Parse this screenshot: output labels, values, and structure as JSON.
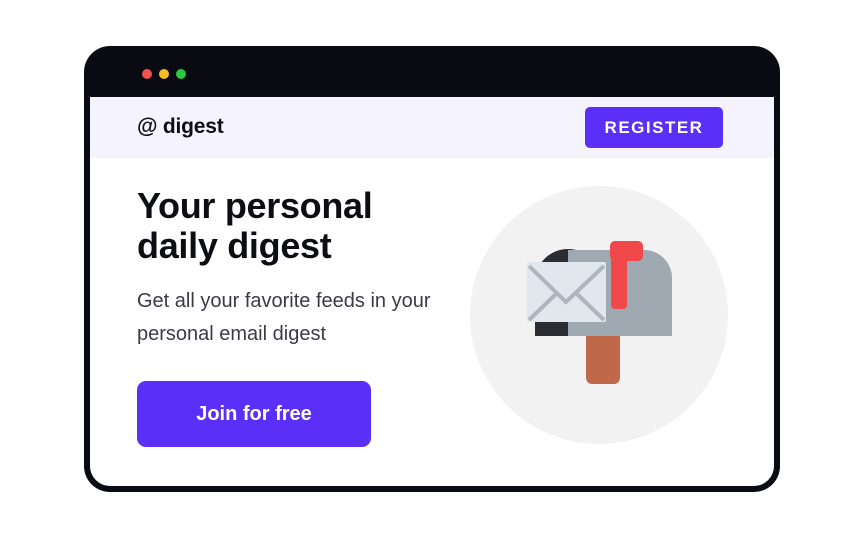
{
  "window": {
    "dots": [
      "red",
      "yellow",
      "green"
    ]
  },
  "navbar": {
    "logo_text": "@ digest",
    "register_label": "REGISTER"
  },
  "hero": {
    "title": "Your personal daily digest",
    "subtitle": "Get all your favorite feeds in your personal email digest",
    "cta_label": "Join for free"
  },
  "colors": {
    "accent": "#5b2ff8",
    "nav_bg": "#f5f4fe",
    "window_frame": "#0a0a12",
    "circle_bg": "#f2f2f2",
    "mailbox_body": "#9ea9b1",
    "mailbox_flag": "#f0484b",
    "mailbox_post": "#c0694a",
    "envelope": "#e1e8ed"
  },
  "illustration": {
    "icon": "mailbox-with-envelope-icon"
  }
}
